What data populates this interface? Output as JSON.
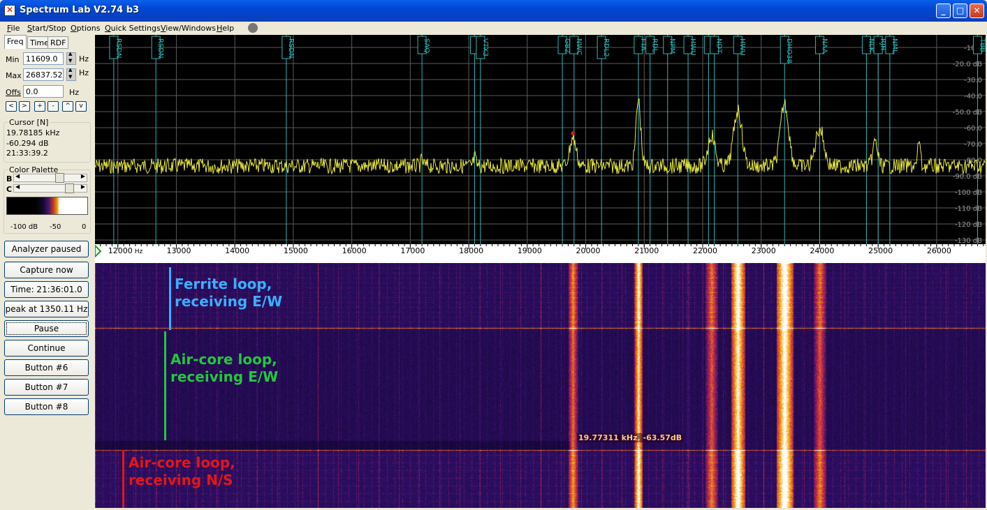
{
  "window": {
    "title": "Spectrum Lab V2.74 b3",
    "icon": "app-icon",
    "minimize": "_",
    "maximize": "□",
    "close": "✕"
  },
  "menu": [
    {
      "label": "File",
      "u": "F",
      "rest": "ile"
    },
    {
      "label": "Start/Stop",
      "u": "S",
      "rest": "tart/Stop"
    },
    {
      "label": "Options",
      "u": "O",
      "rest": "ptions"
    },
    {
      "label": "Quick Settings",
      "u": "Q",
      "rest": "uick Settings"
    },
    {
      "label": "View/Windows",
      "u": "V",
      "rest": "iew/Windows"
    },
    {
      "label": "Help",
      "u": "H",
      "rest": "elp"
    }
  ],
  "tabs": [
    "Freq",
    "Time",
    "RDF"
  ],
  "freq": {
    "min_label": "Min",
    "min_value": "11609.0",
    "max_label": "Max",
    "max_value": "26837.52",
    "offs_label": "Offs",
    "offs_value": "0.0",
    "unit": "Hz",
    "nav_buttons": [
      "<",
      ">",
      "+",
      "-",
      "^",
      "v"
    ]
  },
  "cursor": {
    "title": "Cursor [N]",
    "freq": "19.78185 kHz",
    "level": "-60.294 dB",
    "time": "21:33:39.2"
  },
  "palette": {
    "title": "Color Palette",
    "b_label": "B",
    "c_label": "C",
    "b_level": 0.62,
    "c_level": 0.78,
    "scale": [
      "-100 dB",
      "-50",
      "0"
    ]
  },
  "buttons": {
    "analyzer": "Analyzer paused",
    "capture": "Capture now",
    "time": "Time:  21:36:01.0",
    "peak": "peak at 1350.11 Hz",
    "pause": "Pause",
    "continue": "Continue",
    "b6": "Button #6",
    "b7": "Button #7",
    "b8": "Button #8"
  },
  "spectrum": {
    "freq_min": 11609.0,
    "freq_max": 26837.52,
    "db_ticks": [
      "-10.0",
      "-20.0 dB",
      "-30.0",
      "-40.0",
      "-50.0 dB",
      "-60.0",
      "-70.0",
      "-80.0",
      "-90.0 dB",
      "-100 dB",
      "-110 dB",
      "-120 dB",
      "-130 dB"
    ],
    "freq_ticks": [
      "12000",
      "13000",
      "14000",
      "15000",
      "16000",
      "17000",
      "18000",
      "19000",
      "20000",
      "21000",
      "22000",
      "23000",
      "24000",
      "25000",
      "26000"
    ],
    "freq_unit": "Hz",
    "markers": [
      {
        "label": "RSDN",
        "f": 11930
      },
      {
        "label": "RSDN",
        "f": 12650
      },
      {
        "label": "RSDN",
        "f": 14880
      },
      {
        "label": "SAQ",
        "f": 17200
      },
      {
        "label": "RDL",
        "f": 18100
      },
      {
        "label": "VTX3",
        "f": 18200
      },
      {
        "label": "GBZ",
        "f": 19600
      },
      {
        "label": "NWC",
        "f": 19800
      },
      {
        "label": "RDL2",
        "f": 20270
      },
      {
        "label": "FTA",
        "f": 20900
      },
      {
        "label": "RDL",
        "f": 21100
      },
      {
        "label": "NPM",
        "f": 21400
      },
      {
        "label": "HWU",
        "f": 21750
      },
      {
        "label": "GQD",
        "f": 22100
      },
      {
        "label": "NDT",
        "f": 22200
      },
      {
        "label": "HWU",
        "f": 22600
      },
      {
        "label": "DHO38",
        "f": 23400
      },
      {
        "label": "NAA",
        "f": 24000
      },
      {
        "label": "NLK",
        "f": 24800
      },
      {
        "label": "RJH",
        "f": 25000
      },
      {
        "label": "NML",
        "f": 25200
      },
      {
        "label": "TBB",
        "f": 26700
      }
    ]
  },
  "waterfall": {
    "cursor_readout": "19.77311 kHz, -63.57dB",
    "annotations": [
      {
        "text1": "Ferrite loop,",
        "text2": "receiving E/W",
        "color": "#3ab0ff"
      },
      {
        "text1": "Air-core loop,",
        "text2": "receiving E/W",
        "color": "#22c83c"
      },
      {
        "text1": "Air-core loop,",
        "text2": "receiving N/S",
        "color": "#e01818"
      }
    ]
  }
}
